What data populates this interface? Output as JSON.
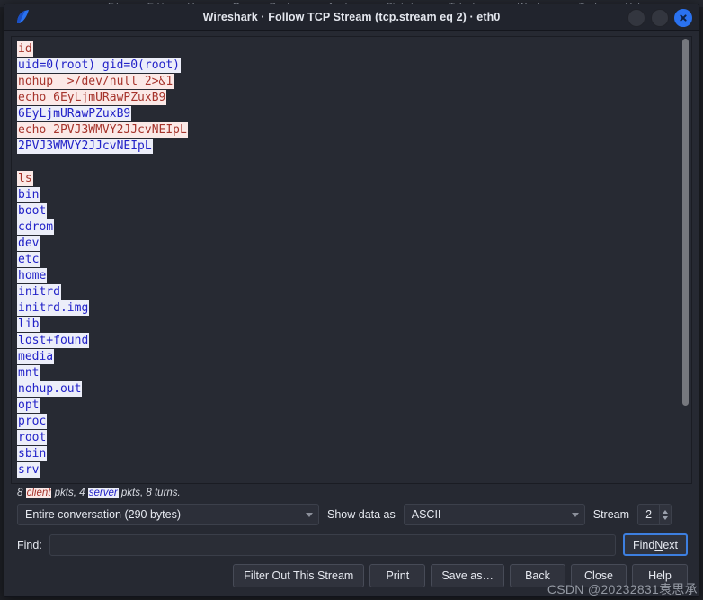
{
  "background_app": {
    "menu_items": [
      "File",
      "Edit",
      "View",
      "Go",
      "Capture",
      "Analyze",
      "Statistics",
      "Telephony",
      "Wireless",
      "Tools",
      "Help"
    ]
  },
  "dialog": {
    "title": "Wireshark · Follow TCP Stream (tcp.stream eq 2) · eth0",
    "logo_icon": "wireshark-fin-icon",
    "window_controls": [
      {
        "name": "minimize-button",
        "icon": "minimize-icon"
      },
      {
        "name": "maximize-button",
        "icon": "maximize-icon"
      },
      {
        "name": "close-button",
        "icon": "close-x-icon"
      }
    ],
    "accent_color": "#2a72f0"
  },
  "stream": {
    "client_color": "#a6342c",
    "client_background": "#fbe9e7",
    "server_color": "#2222c8",
    "server_background": "#eceef9",
    "lines": [
      {
        "side": "client",
        "text": "id"
      },
      {
        "side": "server",
        "text": "uid=0(root) gid=0(root)"
      },
      {
        "side": "client",
        "text": "nohup  >/dev/null 2>&1"
      },
      {
        "side": "client",
        "text": "echo 6EyLjmURawPZuxB9"
      },
      {
        "side": "server",
        "text": "6EyLjmURawPZuxB9"
      },
      {
        "side": "client",
        "text": "echo 2PVJ3WMVY2JJcvNEIpL"
      },
      {
        "side": "server",
        "text": "2PVJ3WMVY2JJcvNEIpL"
      },
      {
        "side": "blank",
        "text": ""
      },
      {
        "side": "client",
        "text": "ls"
      },
      {
        "side": "server",
        "text": "bin"
      },
      {
        "side": "server",
        "text": "boot"
      },
      {
        "side": "server",
        "text": "cdrom"
      },
      {
        "side": "server",
        "text": "dev"
      },
      {
        "side": "server",
        "text": "etc"
      },
      {
        "side": "server",
        "text": "home"
      },
      {
        "side": "server",
        "text": "initrd"
      },
      {
        "side": "server",
        "text": "initrd.img"
      },
      {
        "side": "server",
        "text": "lib"
      },
      {
        "side": "server",
        "text": "lost+found"
      },
      {
        "side": "server",
        "text": "media"
      },
      {
        "side": "server",
        "text": "mnt"
      },
      {
        "side": "server",
        "text": "nohup.out"
      },
      {
        "side": "server",
        "text": "opt"
      },
      {
        "side": "server",
        "text": "proc"
      },
      {
        "side": "server",
        "text": "root"
      },
      {
        "side": "server",
        "text": "sbin"
      },
      {
        "side": "server",
        "text": "srv"
      }
    ],
    "scrollbar": {
      "name": "vertical-scrollbar",
      "thumb_fraction": 0.83
    }
  },
  "status": {
    "client_pkts_count": "8",
    "client_word": "client",
    "middle_text": " pkts, ",
    "server_pkts_count": "4",
    "server_word": "server",
    "tail_text": " pkts, 8 turns."
  },
  "controls": {
    "conversation_value": "Entire conversation (290 bytes)",
    "show_data_as_label": "Show data as",
    "show_data_as_value": "ASCII",
    "stream_label": "Stream",
    "stream_value": "2"
  },
  "find": {
    "label": "Find:",
    "value": "",
    "placeholder": "",
    "button_prefix": "Find ",
    "button_mnemonic": "N",
    "button_suffix": "ext"
  },
  "buttons": {
    "filter_out": "Filter Out This Stream",
    "print": "Print",
    "save_as": "Save as…",
    "back": "Back",
    "close": "Close",
    "help": "Help"
  },
  "watermark": {
    "text": "CSDN @20232831袁思承"
  }
}
